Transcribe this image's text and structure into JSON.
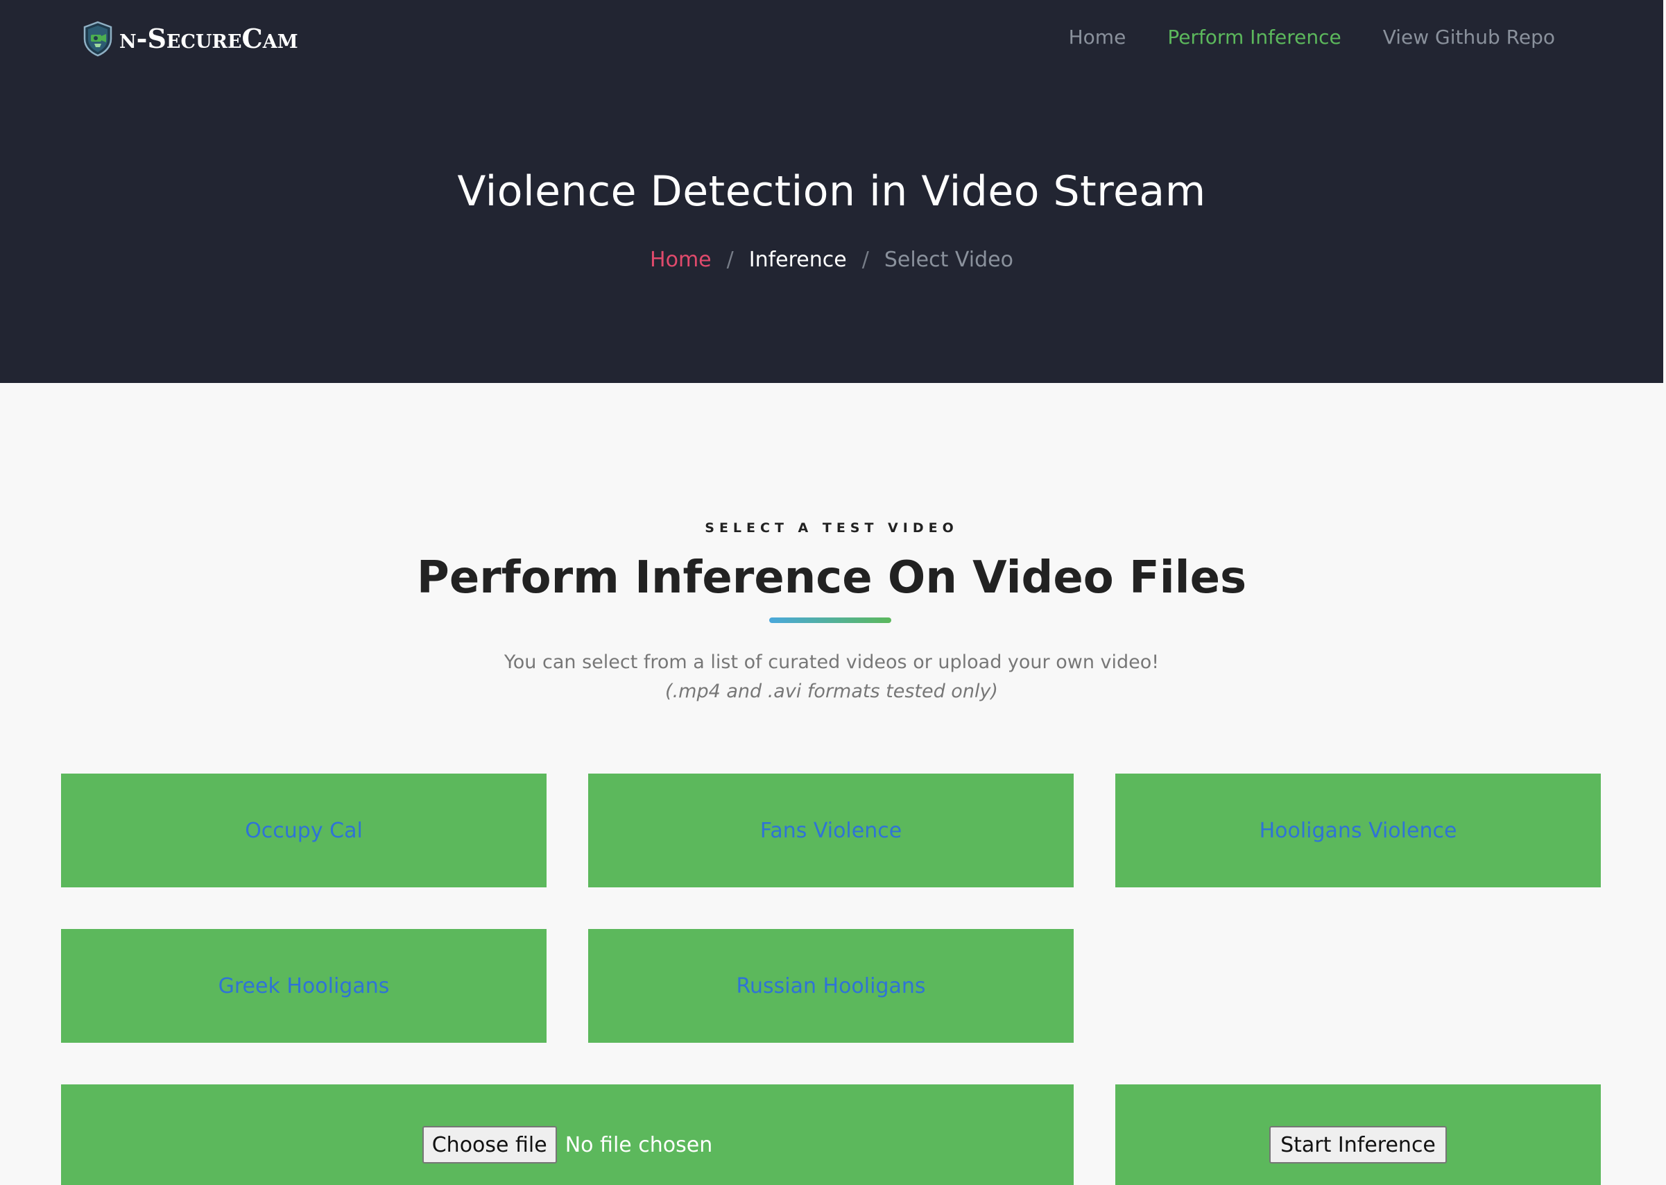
{
  "brand": {
    "name": "n-SecureCam",
    "logo_icon": "shield-camera-icon"
  },
  "nav": {
    "items": [
      {
        "label": "Home",
        "active": false
      },
      {
        "label": "Perform Inference",
        "active": true
      },
      {
        "label": "View Github Repo",
        "active": false
      }
    ]
  },
  "hero": {
    "title": "Violence Detection in Video Stream",
    "breadcrumb": {
      "home": "Home",
      "separator": "/",
      "inference": "Inference",
      "current": "Select Video"
    }
  },
  "section": {
    "eyebrow": "SELECT A TEST VIDEO",
    "title": "Perform Inference On Video Files",
    "description": "You can select from a list of curated videos or upload your own video!",
    "note": "(.mp4 and .avi formats tested only)"
  },
  "videos": [
    {
      "label": "Occupy Cal"
    },
    {
      "label": "Fans Violence"
    },
    {
      "label": "Hooligans Violence"
    },
    {
      "label": "Greek Hooligans"
    },
    {
      "label": "Russian Hooligans"
    }
  ],
  "upload": {
    "choose_label": "Choose file",
    "status": "No file chosen"
  },
  "actions": {
    "start_label": "Start Inference"
  },
  "colors": {
    "header_bg": "#222532",
    "accent_green": "#5cb85c",
    "breadcrumb_home": "#e04a6c",
    "tile_link": "#2f73d6",
    "page_bg": "#f8f8f8"
  }
}
